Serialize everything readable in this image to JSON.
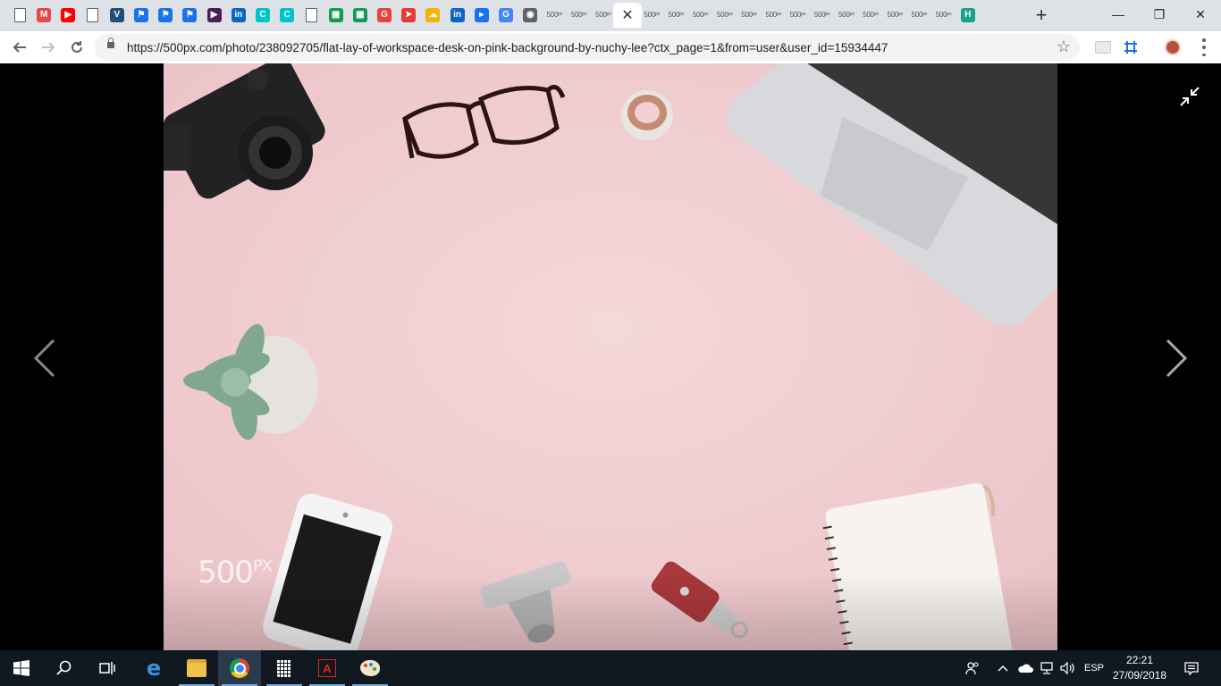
{
  "browser": {
    "tabs": [
      {
        "icon": "document-icon",
        "type": "doc"
      },
      {
        "icon": "mendeley-icon",
        "type": "badge",
        "glyph": "M",
        "color": "#e5484d"
      },
      {
        "icon": "youtube-icon",
        "type": "badge",
        "glyph": "▶",
        "color": "#ff0000"
      },
      {
        "icon": "document-icon",
        "type": "doc"
      },
      {
        "icon": "vertex-icon",
        "type": "badge",
        "glyph": "V",
        "color": "#1f4e79"
      },
      {
        "icon": "flag-icon",
        "type": "badge",
        "glyph": "⚑",
        "color": "#1a73e8"
      },
      {
        "icon": "flag-icon",
        "type": "badge",
        "glyph": "⚑",
        "color": "#1a73e8"
      },
      {
        "icon": "flag-icon",
        "type": "badge",
        "glyph": "⚑",
        "color": "#1a73e8"
      },
      {
        "icon": "play-icon",
        "type": "badge",
        "glyph": "▶",
        "color": "#4a1d5c"
      },
      {
        "icon": "linkedin-icon",
        "type": "badge",
        "glyph": "in",
        "color": "#0a66c2"
      },
      {
        "icon": "canva-icon",
        "type": "badge",
        "glyph": "C",
        "color": "#00c4cc"
      },
      {
        "icon": "canva-icon",
        "type": "badge",
        "glyph": "C",
        "color": "#00c4cc"
      },
      {
        "icon": "document-icon",
        "type": "doc"
      },
      {
        "icon": "sheets-icon",
        "type": "badge",
        "glyph": "▦",
        "color": "#0f9d58"
      },
      {
        "icon": "sheets-icon",
        "type": "badge",
        "glyph": "▦",
        "color": "#0f9d58"
      },
      {
        "icon": "google-icon",
        "type": "badge",
        "glyph": "G",
        "color": "#ea4335"
      },
      {
        "icon": "redirect-icon",
        "type": "badge",
        "glyph": "➤",
        "color": "#e53935"
      },
      {
        "icon": "rainbow-icon",
        "type": "badge",
        "glyph": "☁",
        "color": "#f4b400"
      },
      {
        "icon": "linkedin-icon",
        "type": "badge",
        "glyph": "in",
        "color": "#0a66c2"
      },
      {
        "icon": "media-icon",
        "type": "badge",
        "glyph": "▸",
        "color": "#1a73e8"
      },
      {
        "icon": "google-icon",
        "type": "badge",
        "glyph": "G",
        "color": "#4285f4"
      },
      {
        "icon": "camera-icon",
        "type": "badge",
        "glyph": "◉",
        "color": "#5f6368"
      },
      {
        "icon": "500px-icon",
        "type": "px",
        "glyph": "500ᵖˣ"
      },
      {
        "icon": "500px-icon",
        "type": "px",
        "glyph": "500ᵖˣ"
      },
      {
        "icon": "500px-icon",
        "type": "px",
        "glyph": "500ᵖˣ"
      },
      {
        "icon": "close-icon",
        "type": "active",
        "glyph": "✕"
      },
      {
        "icon": "500px-icon",
        "type": "px",
        "glyph": "500ᵖˣ"
      },
      {
        "icon": "500px-icon",
        "type": "px",
        "glyph": "500ᵖˣ"
      },
      {
        "icon": "500px-icon",
        "type": "px",
        "glyph": "500ᵖˣ"
      },
      {
        "icon": "500px-icon",
        "type": "px",
        "glyph": "500ᵖˣ"
      },
      {
        "icon": "500px-icon",
        "type": "px",
        "glyph": "500ᵖˣ"
      },
      {
        "icon": "500px-icon",
        "type": "px",
        "glyph": "500ᵖˣ"
      },
      {
        "icon": "500px-icon",
        "type": "px",
        "glyph": "500ᵖˣ"
      },
      {
        "icon": "500px-icon",
        "type": "px",
        "glyph": "500ᵖˣ"
      },
      {
        "icon": "500px-icon",
        "type": "px",
        "glyph": "500ᵖˣ"
      },
      {
        "icon": "500px-icon",
        "type": "px",
        "glyph": "500ᵖˣ"
      },
      {
        "icon": "500px-icon",
        "type": "px",
        "glyph": "500ᵖˣ"
      },
      {
        "icon": "500px-icon",
        "type": "px",
        "glyph": "500ᵖˣ"
      },
      {
        "icon": "500px-icon",
        "type": "px",
        "glyph": "500ᵖˣ"
      },
      {
        "icon": "hootsuite-icon",
        "type": "badge",
        "glyph": "H",
        "color": "#1aa38a"
      }
    ],
    "new_tab_glyph": "+",
    "window_controls": {
      "minimize": "—",
      "restore": "❐",
      "close": "✕"
    },
    "url": "https://500px.com/photo/238092705/flat-lay-of-workspace-desk-on-pink-background-by-nuchy-lee?ctx_page=1&from=user&user_id=15934447"
  },
  "viewer": {
    "watermark_main": "500",
    "watermark_sup": "PX"
  },
  "taskbar": {
    "language": "ESP",
    "time": "22:21",
    "date": "27/09/2018"
  },
  "colors": {
    "photo_bg": "#f1cfd2",
    "taskbar": "#101820"
  }
}
